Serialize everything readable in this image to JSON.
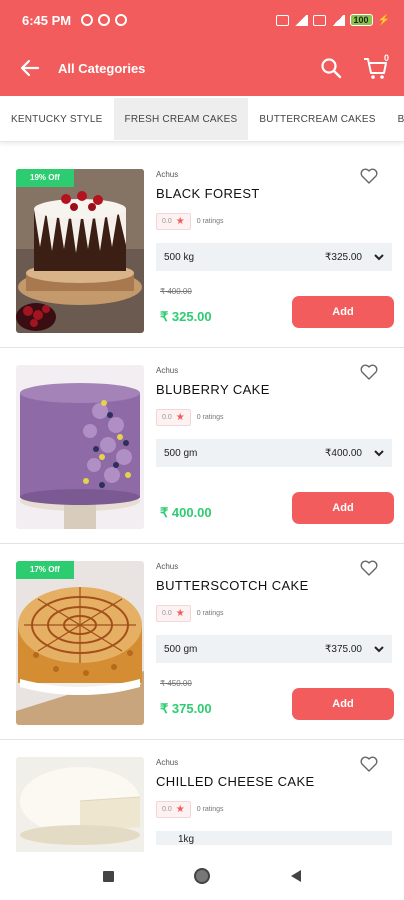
{
  "status": {
    "time": "6:45 PM",
    "battery": "100"
  },
  "appbar": {
    "title": "All Categories",
    "cart_count": "0"
  },
  "tabs": [
    {
      "label": "KENTUCKY STYLE",
      "active": false
    },
    {
      "label": "FRESH CREAM CAKES",
      "active": true
    },
    {
      "label": "BUTTERCREAM CAKES",
      "active": false
    },
    {
      "label": "BURG",
      "active": false
    }
  ],
  "products": [
    {
      "discount": "19% Off",
      "brand": "Achus",
      "name": "BLACK FOREST",
      "rating": "0.0",
      "ratings_label": "0 ratings",
      "variant": "500 kg",
      "variant_price": "₹325.00",
      "old_price": "₹ 400.00",
      "price": "₹ 325.00",
      "add_label": "Add"
    },
    {
      "discount": "",
      "brand": "Achus",
      "name": "BLUBERRY CAKE",
      "rating": "0.0",
      "ratings_label": "0 ratings",
      "variant": "500 gm",
      "variant_price": "₹400.00",
      "old_price": "",
      "price": "₹ 400.00",
      "add_label": "Add"
    },
    {
      "discount": "17% Off",
      "brand": "Achus",
      "name": "BUTTERSCOTCH CAKE",
      "rating": "0.0",
      "ratings_label": "0 ratings",
      "variant": "500 gm",
      "variant_price": "₹375.00",
      "old_price": "₹ 450.00",
      "price": "₹ 375.00",
      "add_label": "Add"
    },
    {
      "discount": "",
      "brand": "Achus",
      "name": "CHILLED CHEESE CAKE",
      "rating": "0.0",
      "ratings_label": "0 ratings",
      "variant": "1kg",
      "variant_price": "",
      "old_price": "",
      "price": "",
      "add_label": ""
    }
  ],
  "colors": {
    "primary": "#f25c5c",
    "success": "#2ecc71",
    "variant_bg": "#eef2f5"
  }
}
